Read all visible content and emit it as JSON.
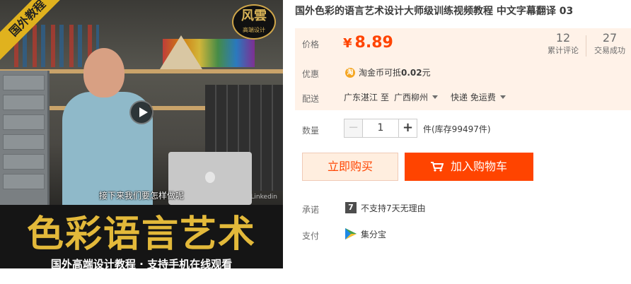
{
  "image": {
    "corner_banner": "国外教程",
    "brand_badge": {
      "line1": "风雲",
      "line2": "高端设计"
    },
    "video_subtitle": "接下来我们要怎样做呢",
    "video_watermark": "Linkedin",
    "poster_title": "色彩语言艺术",
    "poster_subtitle": "国外高端设计教程 · 支持手机在线观看"
  },
  "product": {
    "title": "国外色彩的语言艺术设计大师级训练视频教程 中文字幕翻译 03"
  },
  "price": {
    "label": "价格",
    "currency": "¥",
    "amount": "8.89",
    "reviews_count": "12",
    "reviews_label": "累计评论",
    "sales_count": "27",
    "sales_label": "交易成功"
  },
  "promo": {
    "label": "优惠",
    "coin_icon_text": "淘",
    "text_prefix": "淘金币可抵",
    "text_value": "0.02",
    "text_suffix": "元"
  },
  "shipping": {
    "label": "配送",
    "from": "广东湛江",
    "to_word": "至",
    "to": "广西柳州",
    "method": "快递 免运费"
  },
  "quantity": {
    "label": "数量",
    "minus": "−",
    "value": "1",
    "plus": "+",
    "stock_text": "件(库存99497件)"
  },
  "actions": {
    "buy_now": "立即购买",
    "add_to_cart": "加入购物车"
  },
  "promise": {
    "label": "承诺",
    "icon_text": "7",
    "text": "不支持7天无理由"
  },
  "payment": {
    "label": "支付",
    "text": "集分宝"
  },
  "colors": {
    "accent": "#ff4400",
    "price_bg": "#fff2e8",
    "buy_now_bg": "#ffeedf"
  }
}
